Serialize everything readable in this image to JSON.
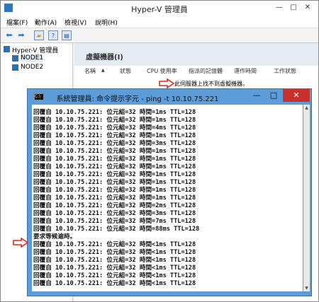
{
  "hyperv": {
    "title": "Hyper-V 管理員",
    "menu": [
      "檔案(F)",
      "動作(A)",
      "檢視(V)",
      "說明(H)"
    ],
    "tree": {
      "root": "Hyper-V 管理員",
      "nodes": [
        "NODE1",
        "NODE2"
      ]
    },
    "section_title": "虛擬機器(I)",
    "columns": [
      "名稱",
      "狀態",
      "CPU 使用率",
      "指派的記憶體",
      "運作時間",
      "工作狀態"
    ],
    "sort_indicator": "▲",
    "empty_message": "此伺服器上找不到虛擬機器。"
  },
  "cmd": {
    "title": "系統管理員: 命令提示字元 - ping  -t 10.10.75.221",
    "lines": [
      "回覆自 10.10.75.221: 位元組=32 時間=1ms TTL=128",
      "回覆自 10.10.75.221: 位元組=32 時間=1ms TTL=128",
      "回覆自 10.10.75.221: 位元組=32 時間=4ms TTL=128",
      "回覆自 10.10.75.221: 位元組=32 時間=1ms TTL=128",
      "回覆自 10.10.75.221: 位元組=32 時間=3ms TTL=128",
      "回覆自 10.10.75.221: 位元組=32 時間=1ms TTL=128",
      "回覆自 10.10.75.221: 位元組=32 時間=1ms TTL=128",
      "回覆自 10.10.75.221: 位元組=32 時間=1ms TTL=128",
      "回覆自 10.10.75.221: 位元組=32 時間=1ms TTL=128",
      "回覆自 10.10.75.221: 位元組=32 時間=1ms TTL=128",
      "回覆自 10.10.75.221: 位元組=32 時間=1ms TTL=128",
      "回覆自 10.10.75.221: 位元組=32 時間=1ms TTL=128",
      "回覆自 10.10.75.221: 位元組=32 時間=2ms TTL=128",
      "回覆自 10.10.75.221: 位元組=32 時間=3ms TTL=128",
      "回覆自 10.10.75.221: 位元組=32 時間=7ms TTL=128",
      "回覆自 10.10.75.221: 位元組=32 時間=88ms TTL=128",
      "要求等候逾時。",
      "回覆自 10.10.75.221: 位元組=32 時間<1ms TTL=128",
      "回覆自 10.10.75.221: 位元組=32 時間<1ms TTL=128",
      "回覆自 10.10.75.221: 位元組=32 時間<1ms TTL=128",
      "回覆自 10.10.75.221: 位元組=32 時間<1ms TTL=128",
      "回覆自 10.10.75.221: 位元組=32 時間<1ms TTL=128",
      "回覆自 10.10.75.221: 位元組=32 時間<1ms TTL=128"
    ]
  },
  "window_buttons": {
    "minimize": "—",
    "maximize": "□",
    "close": "✕"
  },
  "colors": {
    "cmd_frame": "#5c9cd8",
    "close_button": "#c9302c",
    "annotation_arrow": "#e0261f",
    "section_header": "#e4ebf3"
  },
  "icons": [
    "hyperv-app-icon",
    "back-icon",
    "forward-icon",
    "folder-icon",
    "help-icon",
    "properties-icon",
    "server-icon",
    "cmd-icon",
    "annotation-arrow-icon"
  ]
}
